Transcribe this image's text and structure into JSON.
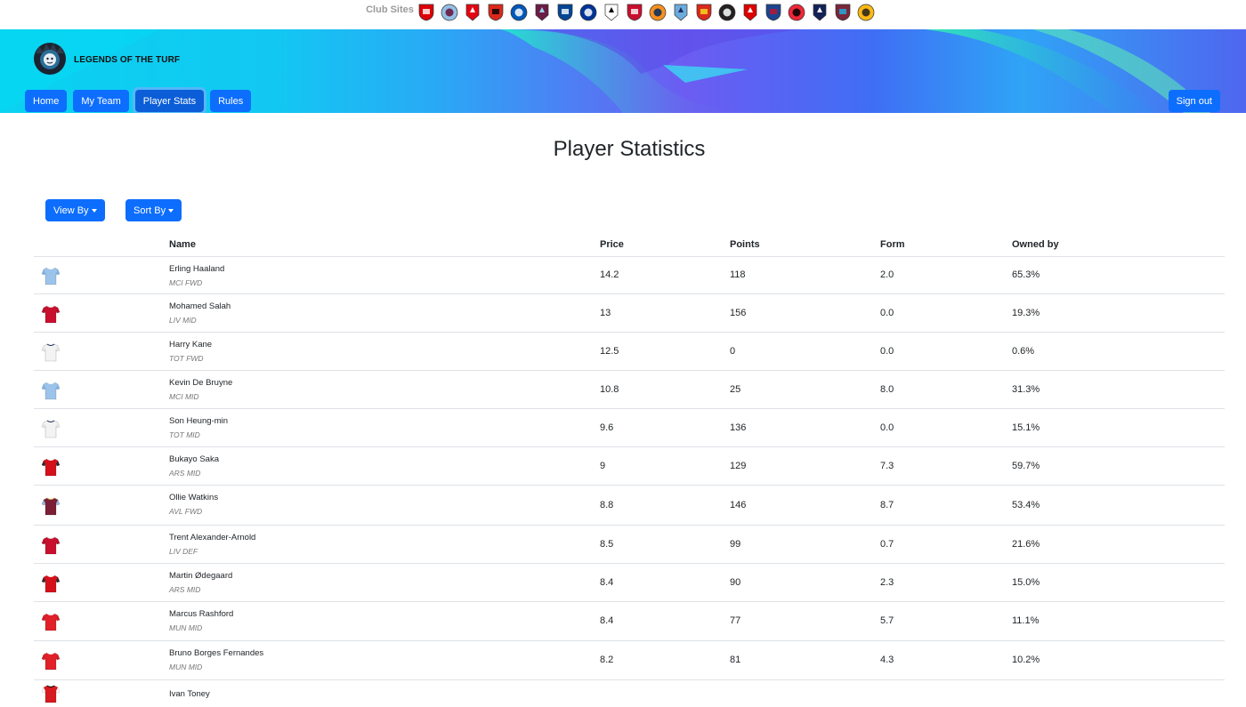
{
  "club_strip": {
    "label": "Club Sites",
    "clubs": [
      {
        "name": "Arsenal",
        "icon": "arsenal-crest-icon",
        "color": "#db0007",
        "accent": "#ffffff"
      },
      {
        "name": "Aston Villa",
        "icon": "aston-villa-crest-icon",
        "color": "#95bfe5",
        "accent": "#670e36"
      },
      {
        "name": "Brentford",
        "icon": "brentford-crest-icon",
        "color": "#e30613",
        "accent": "#ffffff"
      },
      {
        "name": "Bournemouth",
        "icon": "bournemouth-crest-icon",
        "color": "#da291c",
        "accent": "#000000"
      },
      {
        "name": "Brighton",
        "icon": "brighton-crest-icon",
        "color": "#0057b8",
        "accent": "#ffffff"
      },
      {
        "name": "Burnley",
        "icon": "burnley-crest-icon",
        "color": "#6c1d45",
        "accent": "#99d6ea"
      },
      {
        "name": "Chelsea",
        "icon": "chelsea-crest-icon",
        "color": "#034694",
        "accent": "#ffffff"
      },
      {
        "name": "Everton",
        "icon": "everton-crest-icon",
        "color": "#003399",
        "accent": "#ffffff"
      },
      {
        "name": "Fulham",
        "icon": "fulham-crest-icon",
        "color": "#ffffff",
        "accent": "#000000"
      },
      {
        "name": "Liverpool",
        "icon": "liverpool-crest-icon",
        "color": "#c8102e",
        "accent": "#ffffff"
      },
      {
        "name": "Luton",
        "icon": "luton-crest-icon",
        "color": "#f78f1e",
        "accent": "#002d62"
      },
      {
        "name": "Manchester City",
        "icon": "man-city-crest-icon",
        "color": "#6cabdd",
        "accent": "#1c2c5b"
      },
      {
        "name": "Manchester United",
        "icon": "man-united-crest-icon",
        "color": "#da291c",
        "accent": "#fbe122"
      },
      {
        "name": "Newcastle",
        "icon": "newcastle-crest-icon",
        "color": "#241f20",
        "accent": "#ffffff"
      },
      {
        "name": "Nottingham Forest",
        "icon": "nottingham-forest-crest-icon",
        "color": "#dd0000",
        "accent": "#ffffff"
      },
      {
        "name": "Crystal Palace",
        "icon": "crystal-palace-crest-icon",
        "color": "#1b458f",
        "accent": "#c4122e"
      },
      {
        "name": "Sheffield United",
        "icon": "sheffield-united-crest-icon",
        "color": "#ee2737",
        "accent": "#000000"
      },
      {
        "name": "Tottenham",
        "icon": "tottenham-crest-icon",
        "color": "#132257",
        "accent": "#ffffff"
      },
      {
        "name": "West Ham",
        "icon": "west-ham-crest-icon",
        "color": "#7a263a",
        "accent": "#1bb1e7"
      },
      {
        "name": "Wolves",
        "icon": "wolves-crest-icon",
        "color": "#fdb913",
        "accent": "#231f20"
      }
    ]
  },
  "header": {
    "brand": "LEGENDS OF THE TURF",
    "logo_icon": "lion-logo-icon",
    "nav": [
      {
        "label": "Home",
        "active": false
      },
      {
        "label": "My Team",
        "active": false
      },
      {
        "label": "Player Stats",
        "active": true
      },
      {
        "label": "Rules",
        "active": false
      }
    ],
    "signout_label": "Sign out"
  },
  "page": {
    "title": "Player Statistics",
    "view_by_label": "View By",
    "sort_by_label": "Sort By"
  },
  "table": {
    "columns": [
      "",
      "Name",
      "Price",
      "Points",
      "Form",
      "Owned by"
    ],
    "rows": [
      {
        "name": "Erling Haaland",
        "team": "MCI FWD",
        "price": "14.2",
        "points": "118",
        "form": "2.0",
        "owned": "65.3%",
        "kit": "mci"
      },
      {
        "name": "Mohamed Salah",
        "team": "LIV MID",
        "price": "13",
        "points": "156",
        "form": "0.0",
        "owned": "19.3%",
        "kit": "liv"
      },
      {
        "name": "Harry Kane",
        "team": "TOT FWD",
        "price": "12.5",
        "points": "0",
        "form": "0.0",
        "owned": "0.6%",
        "kit": "tot"
      },
      {
        "name": "Kevin De Bruyne",
        "team": "MCI MID",
        "price": "10.8",
        "points": "25",
        "form": "8.0",
        "owned": "31.3%",
        "kit": "mci"
      },
      {
        "name": "Son Heung-min",
        "team": "TOT MID",
        "price": "9.6",
        "points": "136",
        "form": "0.0",
        "owned": "15.1%",
        "kit": "tot"
      },
      {
        "name": "Bukayo Saka",
        "team": "ARS MID",
        "price": "9",
        "points": "129",
        "form": "7.3",
        "owned": "59.7%",
        "kit": "ars"
      },
      {
        "name": "Ollie Watkins",
        "team": "AVL FWD",
        "price": "8.8",
        "points": "146",
        "form": "8.7",
        "owned": "53.4%",
        "kit": "avl"
      },
      {
        "name": "Trent Alexander-Arnold",
        "team": "LIV DEF",
        "price": "8.5",
        "points": "99",
        "form": "0.7",
        "owned": "21.6%",
        "kit": "liv"
      },
      {
        "name": "Martin Ødegaard",
        "team": "ARS MID",
        "price": "8.4",
        "points": "90",
        "form": "2.3",
        "owned": "15.0%",
        "kit": "ars"
      },
      {
        "name": "Marcus Rashford",
        "team": "MUN MID",
        "price": "8.4",
        "points": "77",
        "form": "5.7",
        "owned": "11.1%",
        "kit": "mun"
      },
      {
        "name": "Bruno Borges Fernandes",
        "team": "MUN MID",
        "price": "8.2",
        "points": "81",
        "form": "4.3",
        "owned": "10.2%",
        "kit": "mun"
      },
      {
        "name": "Ivan Toney",
        "team": "",
        "price": "",
        "points": "",
        "form": "",
        "owned": "",
        "kit": "bre"
      }
    ]
  },
  "kits": {
    "mci": {
      "body": "#9cc4ea",
      "sleeve": "#7fb0de",
      "trim": "#ffffff"
    },
    "liv": {
      "body": "#c8102e",
      "sleeve": "#b00d26",
      "trim": "#e0e0e0"
    },
    "tot": {
      "body": "#f3f3f3",
      "sleeve": "#e4e4e4",
      "trim": "#1c2450"
    },
    "ars": {
      "body": "#d4111b",
      "sleeve": "#2b2b2b",
      "trim": "#ffffff"
    },
    "avl": {
      "body": "#7a1f35",
      "sleeve": "#8fb8de",
      "trim": "#e0c060"
    },
    "mun": {
      "body": "#e0212a",
      "sleeve": "#cc1c24",
      "trim": "#ffffff"
    },
    "bre": {
      "body": "#d71920",
      "sleeve": "#ffffff",
      "trim": "#000000"
    }
  }
}
